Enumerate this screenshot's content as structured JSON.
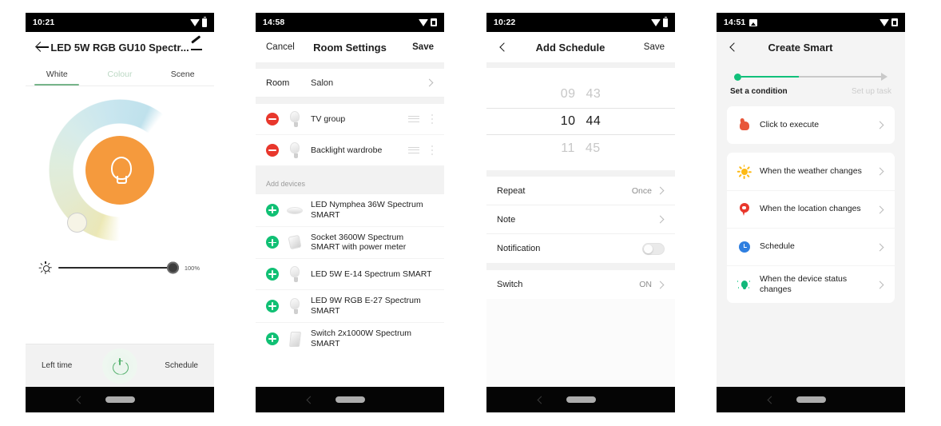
{
  "phones": [
    {
      "id": "device-detail",
      "statusbar": {
        "time": "10:21",
        "wifi_icon": "wifi-icon",
        "battery_icon": "battery-icon"
      },
      "appbar": {
        "back_icon": "back-arrow-icon",
        "title": "LED 5W RGB GU10 Spectr...",
        "edit_icon": "pencil-icon"
      },
      "tabs": [
        {
          "label": "White",
          "state": "active"
        },
        {
          "label": "Colour",
          "state": "muted"
        },
        {
          "label": "Scene",
          "state": "normal"
        }
      ],
      "dial": {
        "icon": "bulb-icon",
        "core_color": "#f59a3d",
        "knob_icon": "dial-knob"
      },
      "brightness": {
        "icon": "brightness-icon",
        "value": "100%",
        "percent": 100
      },
      "bottom": {
        "left_label": "Left time",
        "power_icon": "power-icon",
        "right_label": "Schedule"
      },
      "nav": {
        "back_icon": "nav-back-icon",
        "home_icon": "home-pill-icon"
      }
    },
    {
      "id": "room-settings",
      "statusbar": {
        "time": "14:58",
        "wifi_icon": "wifi-icon",
        "battery_icon": "battery-icon"
      },
      "appbar": {
        "cancel_label": "Cancel",
        "title": "Room Settings",
        "save_label": "Save"
      },
      "room_row": {
        "key": "Room",
        "value": "Salon",
        "chevron": "chevron-right-icon"
      },
      "assigned": [
        {
          "name": "TV group",
          "action_icon": "remove-icon",
          "thumb": "bulb-thumb",
          "drag_icon": "drag-handle-icon"
        },
        {
          "name": "Backlight wardrobe",
          "action_icon": "remove-icon",
          "thumb": "bulb-thumb",
          "drag_icon": "drag-handle-icon"
        }
      ],
      "section_header": "Add devices",
      "available": [
        {
          "name": "LED Nymphea 36W Spectrum SMART",
          "action_icon": "add-icon",
          "thumb": "ceiling-thumb"
        },
        {
          "name": "Socket 3600W Spectrum SMART with power meter",
          "action_icon": "add-icon",
          "thumb": "socket-thumb"
        },
        {
          "name": "LED 5W E-14 Spectrum SMART",
          "action_icon": "add-icon",
          "thumb": "bulb-thumb"
        },
        {
          "name": "LED 9W RGB E-27 Spectrum SMART",
          "action_icon": "add-icon",
          "thumb": "bulb-thumb"
        },
        {
          "name": "Switch 2x1000W Spectrum SMART",
          "action_icon": "add-icon",
          "thumb": "switch-thumb"
        }
      ],
      "nav": {
        "back_icon": "nav-back-icon",
        "home_icon": "home-pill-icon"
      }
    },
    {
      "id": "add-schedule",
      "statusbar": {
        "time": "10:22",
        "wifi_icon": "wifi-icon",
        "battery_icon": "battery-icon"
      },
      "appbar": {
        "back_icon": "back-chevron-icon",
        "title": "Add Schedule",
        "save_label": "Save"
      },
      "timepicker": {
        "rows": [
          {
            "hour": "09",
            "minute": "43",
            "selected": false
          },
          {
            "hour": "10",
            "minute": "44",
            "selected": true
          },
          {
            "hour": "11",
            "minute": "45",
            "selected": false
          }
        ]
      },
      "settings": [
        {
          "label": "Repeat",
          "value": "Once",
          "chevron": true,
          "toggle": false
        },
        {
          "label": "Note",
          "value": "",
          "chevron": true,
          "toggle": false
        },
        {
          "label": "Notification",
          "value": "",
          "chevron": false,
          "toggle": true,
          "toggle_state": "off"
        }
      ],
      "switch_row": {
        "label": "Switch",
        "value": "ON",
        "chevron": true
      },
      "nav": {
        "back_icon": "nav-back-icon",
        "home_icon": "home-pill-icon"
      }
    },
    {
      "id": "create-smart",
      "statusbar": {
        "time": "14:51",
        "extra_icon": "gallery-icon",
        "wifi_icon": "wifi-icon",
        "battery_icon": "battery-icon"
      },
      "appbar": {
        "back_icon": "back-chevron-icon",
        "title": "Create Smart"
      },
      "stepper": {
        "step_done_label": "Set a condition",
        "step_next_label": "Set up task",
        "active_color": "#11c07a",
        "inactive_color": "#c9c9c9"
      },
      "primary_card": [
        {
          "label": "Click to execute",
          "icon": "hand-tap-icon",
          "color": "#e8573a"
        }
      ],
      "condition_card": [
        {
          "label": "When the weather changes",
          "icon": "sun-icon",
          "color": "#fdb913"
        },
        {
          "label": "When the location changes",
          "icon": "location-pin-icon",
          "color": "#e8372c"
        },
        {
          "label": "Schedule",
          "icon": "clock-icon",
          "color": "#2f7fe0"
        },
        {
          "label": "When the device status changes",
          "icon": "device-icon",
          "color": "#11b87a"
        }
      ],
      "nav": {
        "back_icon": "nav-back-icon",
        "home_icon": "home-pill-icon"
      }
    }
  ]
}
